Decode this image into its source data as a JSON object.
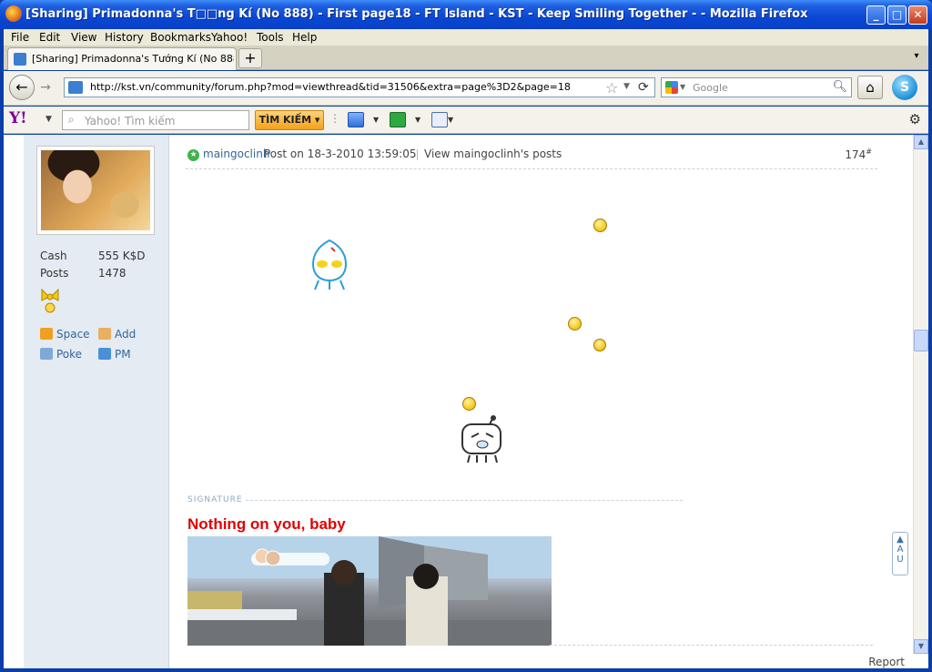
{
  "window": {
    "title": "[Sharing] Primadonna's T□□ng Kí (No 888) - First page18 - FT Island - KST - Keep Smiling Together - - Mozilla Firefox",
    "minimize": "_",
    "maximize": "□",
    "close": "✕"
  },
  "menu": [
    "File",
    "Edit",
    "View",
    "History",
    "Bookmarks",
    "Yahoo!",
    "Tools",
    "Help"
  ],
  "tab": {
    "label": "[Sharing] Primadonna's Tướng Kí (No 888) - ...",
    "new_tab": "+",
    "list": "▾"
  },
  "nav": {
    "back": "←",
    "forward": "→",
    "url": "http://kst.vn/community/forum.php?mod=viewthread&tid=31506&extra=page%3D2&page=18",
    "star": "☆",
    "reload": "⟳",
    "search_placeholder": "Google",
    "home": "⌂",
    "skype": "S"
  },
  "yahoo": {
    "logo": "Y!",
    "search_placeholder": "Yahoo! Tìm kiếm",
    "search_button": "TÌM KIẾM ▾"
  },
  "profile": {
    "cash_label": "Cash",
    "cash_value": "555 K$D",
    "posts_label": "Posts",
    "posts_value": "1478",
    "links": {
      "space": "Space",
      "add": "Add",
      "poke": "Poke",
      "pm": "PM"
    }
  },
  "post": {
    "author": "maingoclinh",
    "meta": "Post on 18-3-2010 13:59:05",
    "view_posts": "View maingoclinh's posts",
    "number": "174",
    "number_suffix": "#",
    "signature_label": "SIGNATURE",
    "signature_title": "Nothing on you, baby",
    "report": "Report"
  },
  "icons": {
    "online": "star-icon",
    "scroll_up": "▲",
    "scroll_down": "▼",
    "to_top": "▲\nA\nU"
  },
  "colors": {
    "title_bar": "#0a47d3",
    "sidebar": "#e4ebf3",
    "link": "#336699",
    "signature_title": "#e00000",
    "yahoo_button": "#f3a11b"
  }
}
